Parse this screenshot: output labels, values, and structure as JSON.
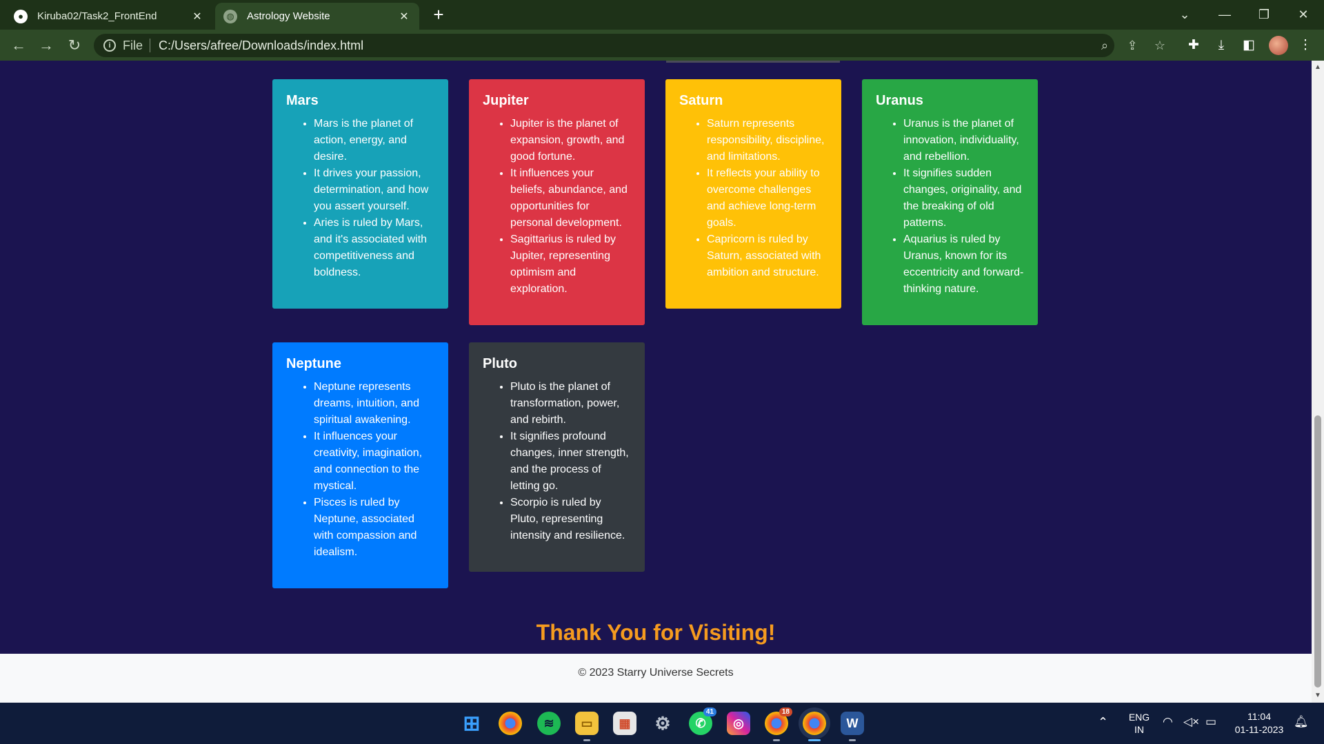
{
  "browser": {
    "tabs": [
      {
        "title": "Kiruba02/Task2_FrontEnd",
        "icon": "github-icon"
      },
      {
        "title": "Astrology Website",
        "icon": "globe-icon"
      }
    ],
    "address": {
      "scheme_label": "File",
      "url": "C:/Users/afree/Downloads/index.html"
    }
  },
  "cards": [
    {
      "name": "Mars",
      "color": "#17a2b8",
      "points": [
        "Mars is the planet of action, energy, and desire.",
        "It drives your passion, determination, and how you assert yourself.",
        "Aries is ruled by Mars, and it's associated with competitiveness and boldness."
      ]
    },
    {
      "name": "Jupiter",
      "color": "#dc3545",
      "points": [
        "Jupiter is the planet of expansion, growth, and good fortune.",
        "It influences your beliefs, abundance, and opportunities for personal development.",
        "Sagittarius is ruled by Jupiter, representing optimism and exploration."
      ]
    },
    {
      "name": "Saturn",
      "color": "#ffc107",
      "points": [
        "Saturn represents responsibility, discipline, and limitations.",
        "It reflects your ability to overcome challenges and achieve long-term goals.",
        "Capricorn is ruled by Saturn, associated with ambition and structure."
      ]
    },
    {
      "name": "Uranus",
      "color": "#28a745",
      "points": [
        "Uranus is the planet of innovation, individuality, and rebellion.",
        "It signifies sudden changes, originality, and the breaking of old patterns.",
        "Aquarius is ruled by Uranus, known for its eccentricity and forward-thinking nature."
      ]
    },
    {
      "name": "Neptune",
      "color": "#007bff",
      "points": [
        "Neptune represents dreams, intuition, and spiritual awakening.",
        "It influences your creativity, imagination, and connection to the mystical.",
        "Pisces is ruled by Neptune, associated with compassion and idealism."
      ]
    },
    {
      "name": "Pluto",
      "color": "#343a40",
      "points": [
        "Pluto is the planet of transformation, power, and rebirth.",
        "It signifies profound changes, inner strength, and the process of letting go.",
        "Scorpio is ruled by Pluto, representing intensity and resilience."
      ]
    }
  ],
  "thanks": "Thank You for Visiting!",
  "footer": "© 2023 Starry Universe Secrets",
  "taskbar": {
    "badges": {
      "whatsapp": "41",
      "chrome_profile": "18"
    },
    "lang_top": "ENG",
    "lang_bottom": "IN",
    "time": "11:04",
    "date": "01-11-2023"
  }
}
